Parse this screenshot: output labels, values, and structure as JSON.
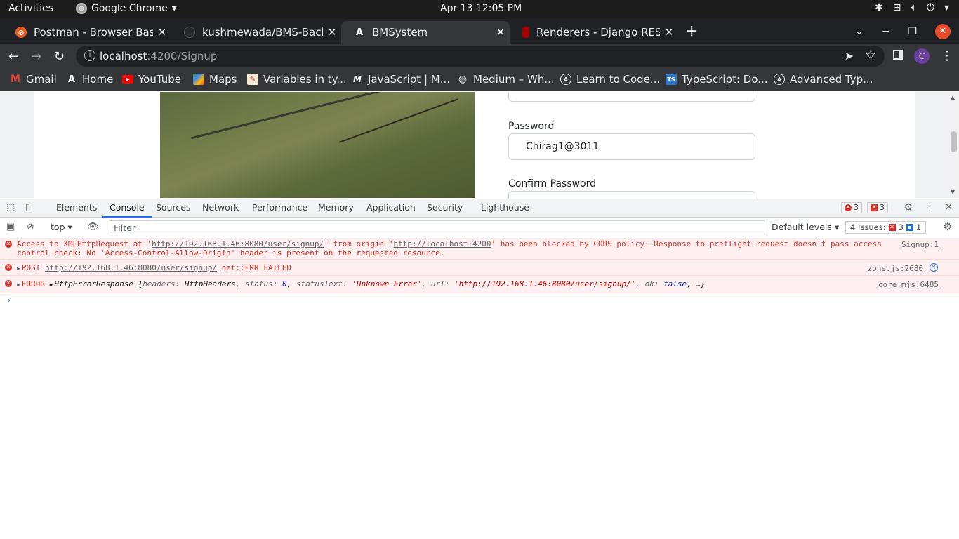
{
  "system_bar": {
    "activities": "Activities",
    "app_name": "Google Chrome",
    "clock": "Apr 13  12:05 PM"
  },
  "tabs": [
    {
      "title": "Postman - Browser Based",
      "favicon": "postman-icon",
      "color": "#ef5b25"
    },
    {
      "title": "kushmewada/BMS-Backe",
      "favicon": "github-icon",
      "color": "#24292e"
    },
    {
      "title": "BMSystem",
      "favicon": "angular-icon",
      "color": "#ffffff"
    },
    {
      "title": "Renderers - Django REST",
      "favicon": "django-rest-icon",
      "color": "#a30000"
    }
  ],
  "omnibox": {
    "host": "localhost",
    "path": ":4200/Signup"
  },
  "profile": {
    "initial": "C"
  },
  "bookmarks": [
    {
      "label": "Gmail",
      "icon": "gmail-icon"
    },
    {
      "label": "Home",
      "icon": "angular-icon"
    },
    {
      "label": "YouTube",
      "icon": "youtube-icon"
    },
    {
      "label": "Maps",
      "icon": "maps-icon"
    },
    {
      "label": "Variables in ty...",
      "icon": "doc-icon"
    },
    {
      "label": "JavaScript | M...",
      "icon": "mdn-icon"
    },
    {
      "label": "Medium – Wh...",
      "icon": "globe-icon"
    },
    {
      "label": "Learn to Code...",
      "icon": "angular-icon"
    },
    {
      "label": "TypeScript: Do...",
      "icon": "typescript-icon"
    },
    {
      "label": "Advanced Typ...",
      "icon": "angular-icon"
    }
  ],
  "page": {
    "password_label": "Password",
    "password_value": "Chirag1@3011",
    "confirm_password_label": "Confirm Password"
  },
  "devtools": {
    "tabs": [
      "Elements",
      "Console",
      "Sources",
      "Network",
      "Performance",
      "Memory",
      "Application",
      "Security",
      "Lighthouse"
    ],
    "active_tab": "Console",
    "error_count": "3",
    "issue_error_count": "3",
    "context": "top",
    "filter_placeholder": "Filter",
    "levels": "Default levels",
    "issues_label": "4 Issues:",
    "issues_errors": "3",
    "issues_info": "1"
  },
  "console": {
    "msg1": {
      "text_a": "Access to XMLHttpRequest at '",
      "link_a": "http://192.168.1.46:8080/user/signup/",
      "text_b": "' from origin '",
      "link_b": "http://localhost:4200",
      "text_c": "' has been blocked by CORS policy: Response to preflight request doesn't pass access control check: No 'Access-Control-Allow-Origin' header is present on the requested resource.",
      "source": "Signup:1"
    },
    "msg2": {
      "method": "POST",
      "url": "http://192.168.1.46:8080/user/signup/",
      "error": "net::ERR_FAILED",
      "source": "zone.js:2680"
    },
    "msg3": {
      "prefix": "ERROR",
      "object": "HttpErrorResponse",
      "k1": "headers:",
      "v1": "HttpHeaders",
      "k2": "status:",
      "v2": "0",
      "k3": "statusText:",
      "v3": "'Unknown Error'",
      "k4": "url:",
      "v4": "'http://192.168.1.46:8080/user/signup/'",
      "k5": "ok:",
      "v5": "false",
      "tail": "…}",
      "source": "core.mjs:6485"
    }
  },
  "colors": {
    "accent": "#1a73e8",
    "error": "#d93025",
    "error_bg": "#fef0f0"
  }
}
